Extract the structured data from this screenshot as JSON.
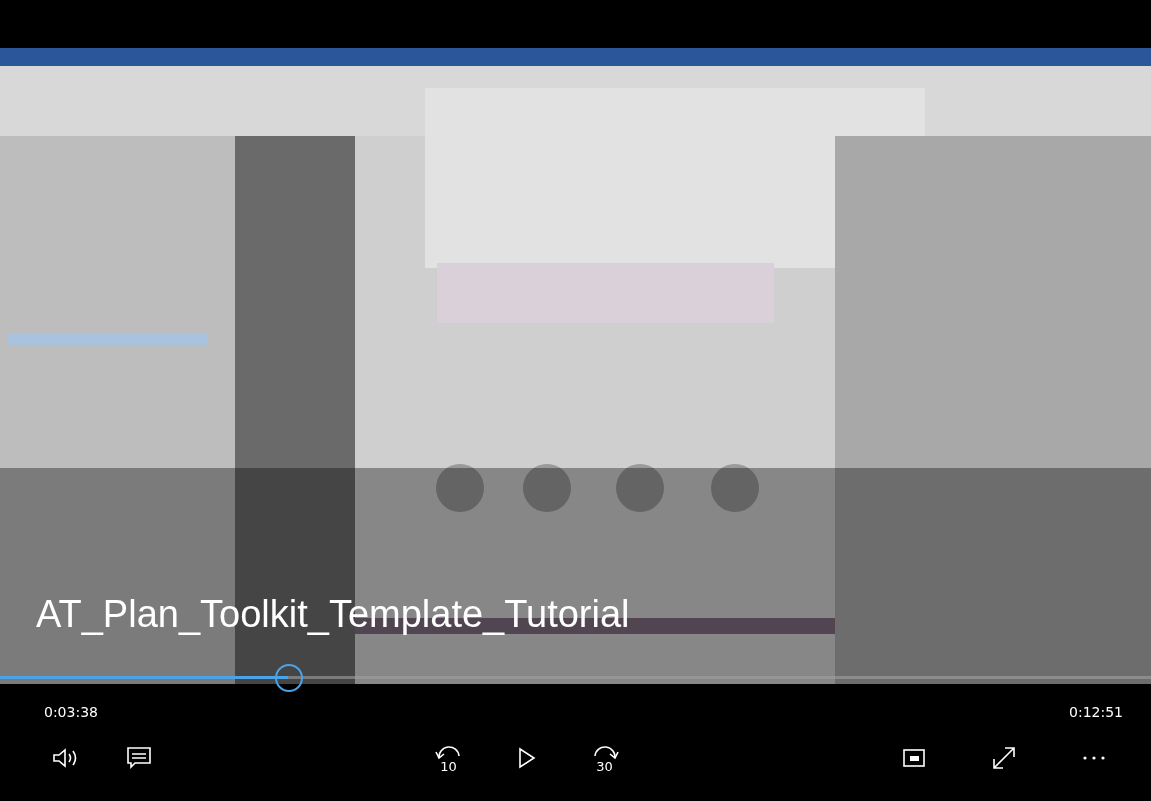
{
  "video": {
    "kind": "picture",
    "title": "AT_Plan_Toolkit_Template_Tutorial"
  },
  "progress": {
    "level": 0.25
  },
  "elapsed": "0:03:38",
  "duration": "0:12:51",
  "controls": {
    "left": [
      {
        "kind": "volume"
      },
      {
        "kind": "captions"
      }
    ],
    "center": [
      {
        "kind": "skip_back",
        "label": "10"
      },
      {
        "kind": "play"
      },
      {
        "kind": "skip_forward",
        "label": "30"
      }
    ],
    "right": [
      {
        "kind": "miniview"
      },
      {
        "kind": "fullscreen"
      },
      {
        "kind": "more"
      }
    ]
  }
}
